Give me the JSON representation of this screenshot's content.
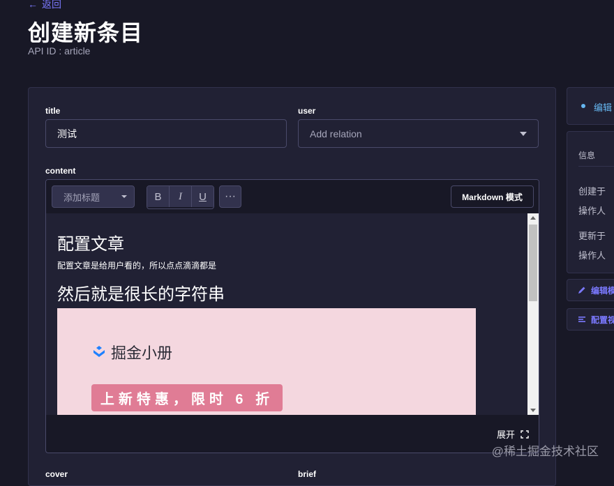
{
  "header": {
    "back_label": "返回",
    "title": "创建新条目",
    "api_id": "API ID : article"
  },
  "form": {
    "title_label": "title",
    "title_value": "测试",
    "user_label": "user",
    "user_placeholder": "Add relation",
    "content_label": "content",
    "cover_label": "cover",
    "brief_label": "brief"
  },
  "editor": {
    "heading_select": "添加标题",
    "bold": "B",
    "italic": "I",
    "underline": "U",
    "more": "···",
    "markdown_mode": "Markdown 模式",
    "expand_label": "展开",
    "content": {
      "h1": "配置文章",
      "paragraph": "配置文章是给用户看的，所以点点滴滴都是",
      "h2": "然后就是很长的字符串",
      "banner_logo_text": "掘金小册",
      "banner_promo": "上新特惠，限时 6 折"
    }
  },
  "sidebar": {
    "edit_tab": "编辑",
    "info_title": "信息",
    "created_at": "创建于",
    "created_by": "操作人",
    "updated_at": "更新于",
    "updated_by": "操作人",
    "edit_model": "编辑模",
    "config_view": "配置视"
  },
  "watermark": "@稀土掘金技术社区",
  "colors": {
    "accent": "#7b79ff",
    "background": "#181826",
    "panel": "#212134"
  }
}
